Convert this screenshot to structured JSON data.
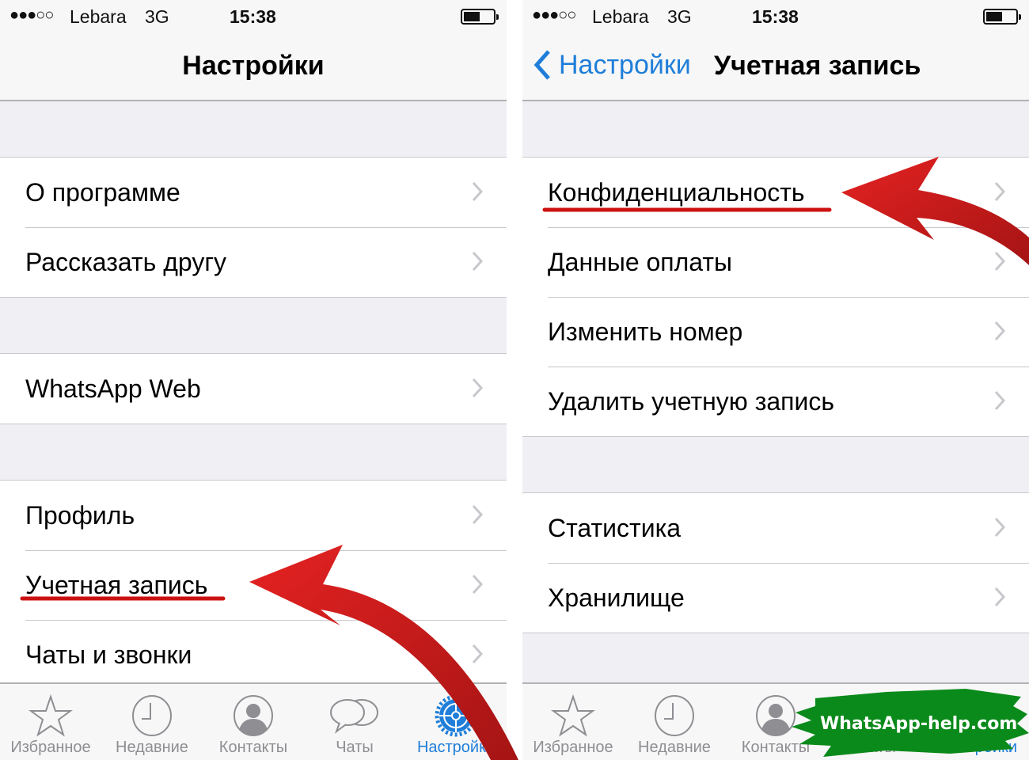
{
  "status_bar": {
    "signal": "●●●○○",
    "carrier": "Lebara",
    "network": "3G",
    "time": "15:38",
    "battery_level_pct": 50
  },
  "left_screen": {
    "title": "Настройки",
    "groups": [
      {
        "items": [
          {
            "label": "О программе"
          },
          {
            "label": "Рассказать другу"
          }
        ]
      },
      {
        "items": [
          {
            "label": "WhatsApp Web"
          }
        ]
      },
      {
        "items": [
          {
            "label": "Профиль"
          },
          {
            "label": "Учетная запись",
            "highlighted": true
          },
          {
            "label": "Чаты и звонки"
          }
        ]
      }
    ]
  },
  "right_screen": {
    "back_label": "Настройки",
    "title": "Учетная запись",
    "groups": [
      {
        "items": [
          {
            "label": "Конфиденциальность",
            "highlighted": true
          },
          {
            "label": "Данные оплаты"
          },
          {
            "label": "Изменить номер"
          },
          {
            "label": "Удалить учетную запись"
          }
        ]
      },
      {
        "items": [
          {
            "label": "Статистика"
          },
          {
            "label": "Хранилище"
          }
        ]
      }
    ]
  },
  "tab_bar": {
    "tabs": [
      {
        "label": "Избранное",
        "icon": "star-icon"
      },
      {
        "label": "Недавние",
        "icon": "clock-icon"
      },
      {
        "label": "Контакты",
        "icon": "contact-icon"
      },
      {
        "label": "Чаты",
        "icon": "chat-bubbles-icon"
      },
      {
        "label": "Настройки",
        "icon": "gear-icon",
        "active": true
      }
    ]
  },
  "watermark": {
    "text": "WhatsApp-help.com"
  },
  "colors": {
    "accent_blue": "#1f7ed9",
    "annotation_red": "#d81e1e",
    "watermark_green": "#0a8a1a",
    "background_gray": "#efeff4"
  }
}
